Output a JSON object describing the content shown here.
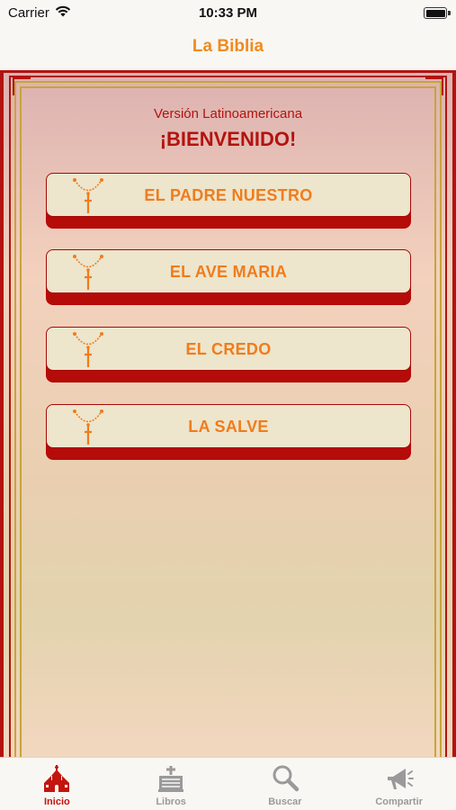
{
  "status_bar": {
    "carrier": "Carrier",
    "time": "10:33 PM"
  },
  "nav": {
    "title": "La Biblia"
  },
  "main": {
    "subtitle": "Versión Latinoamericana",
    "welcome": "¡BIENVENIDO!",
    "prayers": [
      {
        "label": "EL PADRE NUESTRO",
        "icon": "rosary-icon"
      },
      {
        "label": "EL AVE MARIA",
        "icon": "rosary-icon"
      },
      {
        "label": "EL CREDO",
        "icon": "rosary-icon"
      },
      {
        "label": "LA SALVE",
        "icon": "rosary-icon"
      }
    ]
  },
  "tabs": [
    {
      "label": "Inicio",
      "icon": "church-icon",
      "active": true
    },
    {
      "label": "Libros",
      "icon": "books-icon",
      "active": false
    },
    {
      "label": "Buscar",
      "icon": "search-icon",
      "active": false
    },
    {
      "label": "Compartir",
      "icon": "megaphone-icon",
      "active": false
    }
  ],
  "colors": {
    "accent": "#f08a1d",
    "brand_red": "#b3130f",
    "button_face": "#ede5cc",
    "gold": "#c8a43a"
  }
}
